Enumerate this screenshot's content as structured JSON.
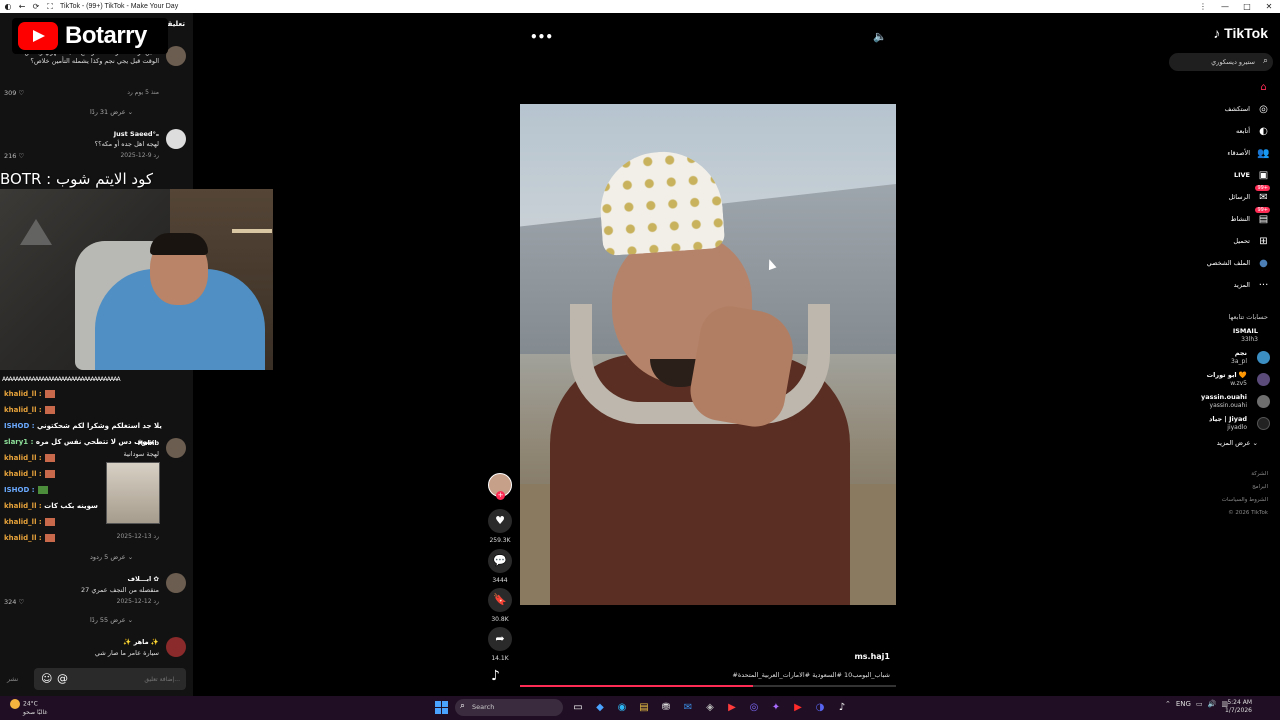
{
  "browser": {
    "title": "TikTok - (99+) TikTok - Make Your Day",
    "icons": [
      "◐",
      "←",
      "⟳",
      "⛶"
    ],
    "controls": [
      "⋮",
      "—",
      "□",
      "✕"
    ]
  },
  "overlay": {
    "channel_name": "Botarry",
    "promo_text": "BOTR : كود الايتم شوب"
  },
  "comments": {
    "header": "تعليقات",
    "items": [
      {
        "user": "",
        "text": "ذحين لو احد سوا حادث وطلع تأمينه سهوي وبنفس الوقت قبل يجي نجم وكذا يشمله التأمين خلاص؟",
        "meta": "منذ 5 يوم   رد",
        "likes": "309 ♡",
        "replies": "عرض 31 ردًا ⌄"
      },
      {
        "user": "Just Saeed°ₒ",
        "text": "لهجه اهل جده أو مكه؟؟",
        "meta": "2025-12-9   رد",
        "likes": "216 ♡",
        "replies": ""
      },
      {
        "user": "Habib",
        "text": "لهجة سودانية",
        "meta": "2025-12-13   رد",
        "likes": "",
        "replies": "عرض 5 ردود ⌄"
      },
      {
        "user": "ابـــلاف ✿",
        "text": "منقصله من النجف عمري 27",
        "meta": "2025-12-12   رد",
        "likes": "324 ♡",
        "replies": "عرض 55 ردًا ⌄"
      },
      {
        "user": "✨ ماهر ✨",
        "text": "سيارة عامر ما صار شي",
        "meta": "",
        "likes": "",
        "replies": ""
      }
    ],
    "input_placeholder": "إضافة تعليق...",
    "post_label": "نشر"
  },
  "chat": {
    "ticker": "AAAAAAAAAAAAAAAAAAAAAAAAAAAAAAAAAAAA",
    "lines": [
      {
        "user": "khalid_ll :",
        "msg": "",
        "color": "u1"
      },
      {
        "user": "khalid_ll :",
        "msg": "",
        "color": "u1"
      },
      {
        "user": "ISHOD :",
        "msg": "يلا جد استغلكم وشكرا لكم شحكتوني",
        "color": "u2"
      },
      {
        "user": "slary1 :",
        "msg": "شوف دس لا تتطحي نفس كل مره",
        "color": "u3"
      },
      {
        "user": "khalid_ll :",
        "msg": "",
        "color": "u1"
      },
      {
        "user": "khalid_ll :",
        "msg": "",
        "color": "u1"
      },
      {
        "user": "ISHOD :",
        "msg": "",
        "color": "u2"
      },
      {
        "user": "khalid_ll :",
        "msg": "سوينه بكب كات",
        "color": "u1"
      },
      {
        "user": "khalid_ll :",
        "msg": "",
        "color": "u1"
      },
      {
        "user": "khalid_ll :",
        "msg": "",
        "color": "u1"
      }
    ]
  },
  "video": {
    "more_icon": "•••",
    "sound_icon": "🔈",
    "progress": 0.62
  },
  "actions": {
    "like_count": "259.3K",
    "comment_count": "3444",
    "save_count": "30.8K",
    "share_count": "14.1K",
    "like_icon": "♥",
    "comment_icon": "💬",
    "save_icon": "🔖",
    "share_icon": "➦",
    "follow_icon": "+",
    "tiktok_icon": "♪"
  },
  "caption": {
    "username": "ms.haj1",
    "tags": "#شباب_البومب10 #السعودية #الامارات_العربية_المتحدة"
  },
  "sidebar": {
    "brand": "♪ TikTok",
    "search_placeholder": "بحث",
    "search_value": "ستيرو ديسكوري",
    "nav": [
      {
        "label": "",
        "icon": "⌂"
      },
      {
        "label": "استكشف",
        "icon": "◎"
      },
      {
        "label": "أتابعه",
        "icon": "◐"
      },
      {
        "label": "الأصدقاء",
        "icon": "👥"
      },
      {
        "label": "LIVE",
        "icon": "▣"
      },
      {
        "label": "الرسائل",
        "icon": "✉",
        "badge": "99+"
      },
      {
        "label": "النشاط",
        "icon": "▤",
        "badge": "99+"
      },
      {
        "label": "تحميل",
        "icon": "⊞"
      },
      {
        "label": "الملف الشخصي",
        "icon": "●"
      },
      {
        "label": "المزيد",
        "icon": "···"
      }
    ],
    "following_title": "حسابات تتابعها",
    "following": [
      {
        "name": "ISMAIL",
        "handle": "33lh3"
      },
      {
        "name": "نجم",
        "handle": "3a_pl"
      },
      {
        "name": "ابو تورات 🧡",
        "handle": "w.zv5"
      },
      {
        "name": "yassin.ouahi",
        "handle": "yassin.ouahi"
      },
      {
        "name": "جياد | Jiyad",
        "handle": "jiyadlo"
      }
    ],
    "see_more": "عرض المزيد ⌄",
    "footer": [
      "الشركة",
      "البرامج",
      "الشروط والسياسات",
      "© 2026 TikTok"
    ]
  },
  "taskbar": {
    "weather_temp": "24°C",
    "weather_desc": "غالبًا صحو",
    "search_label": "Search",
    "search_icon": "⌕",
    "apps": [
      "▭",
      "◆",
      "◉",
      "▤",
      "⛃",
      "✉",
      "◈",
      "▶",
      "◎",
      "✦",
      "▶",
      "◑",
      "♪"
    ],
    "tray": [
      "⌃",
      "ENG",
      "▭",
      "🔊",
      "▥"
    ],
    "time": "5:24 AM",
    "date": "1/7/2026"
  }
}
